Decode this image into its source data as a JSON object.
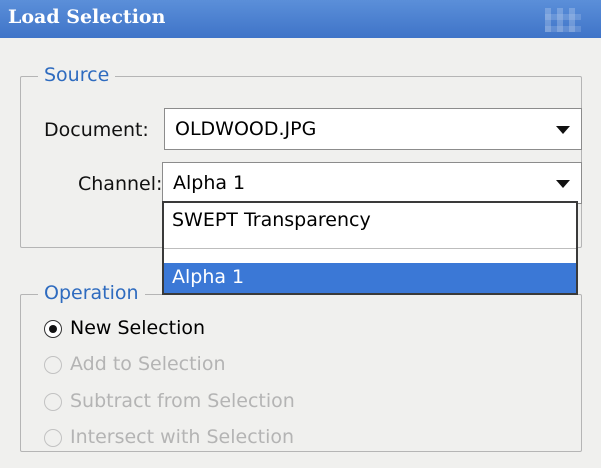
{
  "window": {
    "title": "Load Selection"
  },
  "source": {
    "legend": "Source",
    "document_label": "Document:",
    "document_value": "OLDWOOD.JPG",
    "channel_label": "Channel:",
    "channel_value": "Alpha 1",
    "channel_options": [
      "SWEPT Transparency",
      "Alpha 1"
    ],
    "channel_highlighted": "Alpha 1"
  },
  "operation": {
    "legend": "Operation",
    "options": [
      {
        "label": "New Selection",
        "selected": true
      },
      {
        "label": "Add to Selection",
        "selected": false
      },
      {
        "label": "Subtract from Selection",
        "selected": false
      },
      {
        "label": "Intersect with Selection",
        "selected": false
      }
    ]
  },
  "colors": {
    "title_bar": "#4a81d3",
    "highlight": "#3b78d6",
    "legend_text": "#2e6bbf"
  }
}
